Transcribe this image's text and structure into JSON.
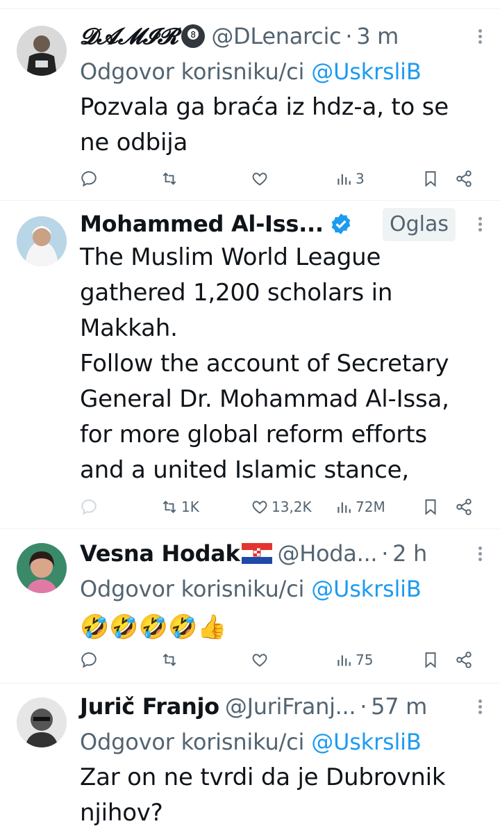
{
  "tweets": [
    {
      "name": "𝓓𝓐𝓜𝓘𝓡",
      "handle": "@DLenarcic",
      "time": "3 m",
      "reply_prefix": "Odgovor korisniku/ci",
      "reply_to": "@UskrsliB",
      "body_lines": [
        "Pozvala ga braća iz hdz-a, to se",
        "ne odbija"
      ],
      "stats": {
        "views": "3"
      }
    },
    {
      "name": "Mohammed Al-Iss...",
      "ad_label": "Oglas",
      "body_lines": [
        "The Muslim World League",
        "gathered 1,200 scholars in",
        "Makkah.",
        "Follow the account of Secretary",
        "General Dr. Mohammad Al-Issa,",
        "for more global reform efforts",
        "and a united Islamic stance,"
      ],
      "stats": {
        "retweets": "1K",
        "likes": "13,2K",
        "views": "72M"
      }
    },
    {
      "name": "Vesna Hodak",
      "handle": "@Hoda...",
      "time": "2 h",
      "reply_prefix": "Odgovor korisniku/ci",
      "reply_to": "@UskrsliB",
      "emojis": "🤣🤣🤣🤣👍",
      "stats": {
        "views": "75"
      }
    },
    {
      "name": "Jurič Franjo",
      "handle": "@JuriFranj...",
      "time": "57 m",
      "reply_prefix": "Odgovor korisniku/ci",
      "reply_to": "@UskrsliB",
      "body_lines": [
        "Zar on ne tvrdi da je Dubrovnik",
        "njihov?"
      ]
    }
  ],
  "colors": {
    "accent": "#1d9bf0",
    "muted": "#536471",
    "text": "#0f1419"
  }
}
